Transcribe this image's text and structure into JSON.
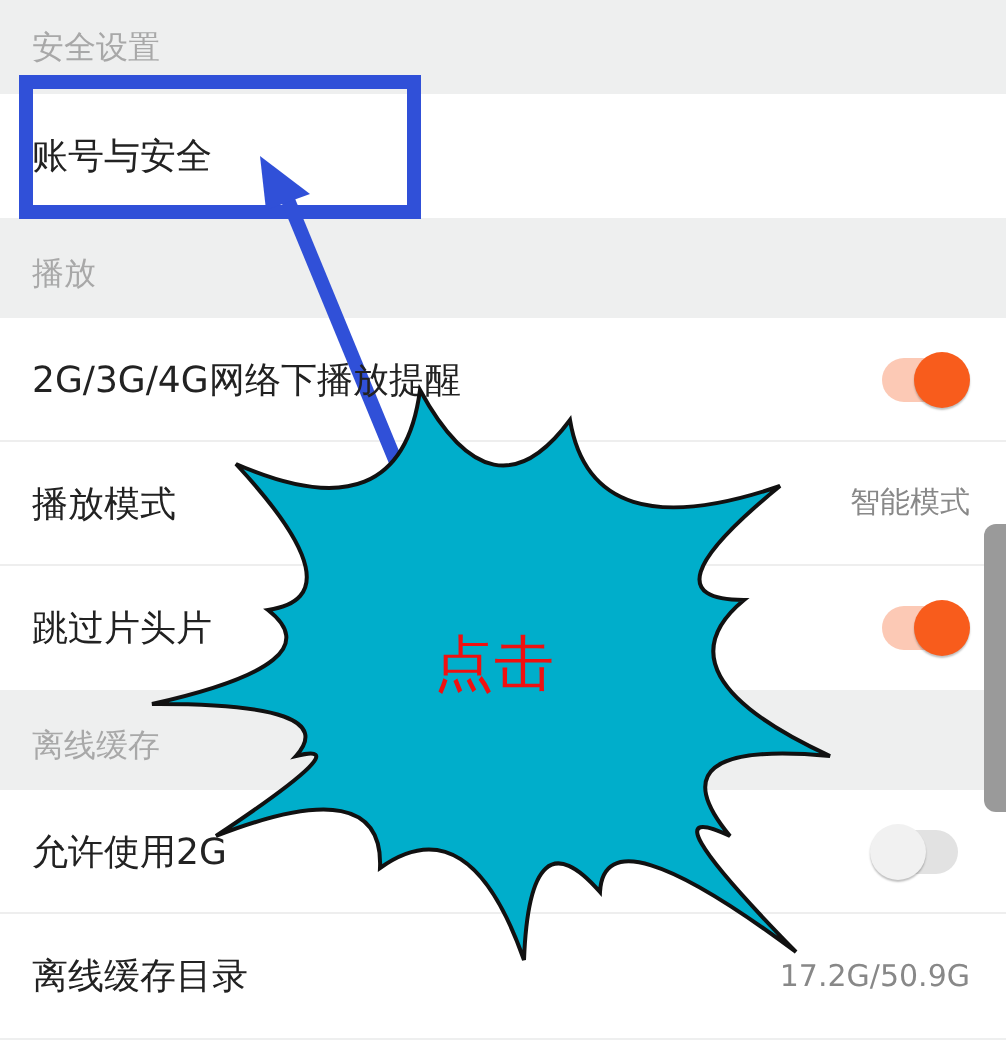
{
  "sections": [
    {
      "title": "安全设置",
      "rows": [
        {
          "kind": "link",
          "label": "账号与安全"
        }
      ]
    },
    {
      "title": "播放",
      "rows": [
        {
          "kind": "toggle",
          "label": "2G/3G/4G网络下播放提醒",
          "on": true
        },
        {
          "kind": "value",
          "label": "播放模式",
          "value": "智能模式"
        },
        {
          "kind": "toggle",
          "label": "跳过片头片",
          "on": true
        }
      ]
    },
    {
      "title": "离线缓存",
      "rows": [
        {
          "kind": "toggle",
          "label": "允许使用2G",
          "on": false
        },
        {
          "kind": "value",
          "label": "离线缓存目录",
          "value": "17.2G/50.9G"
        }
      ]
    }
  ],
  "annotation": {
    "label": "点击"
  }
}
